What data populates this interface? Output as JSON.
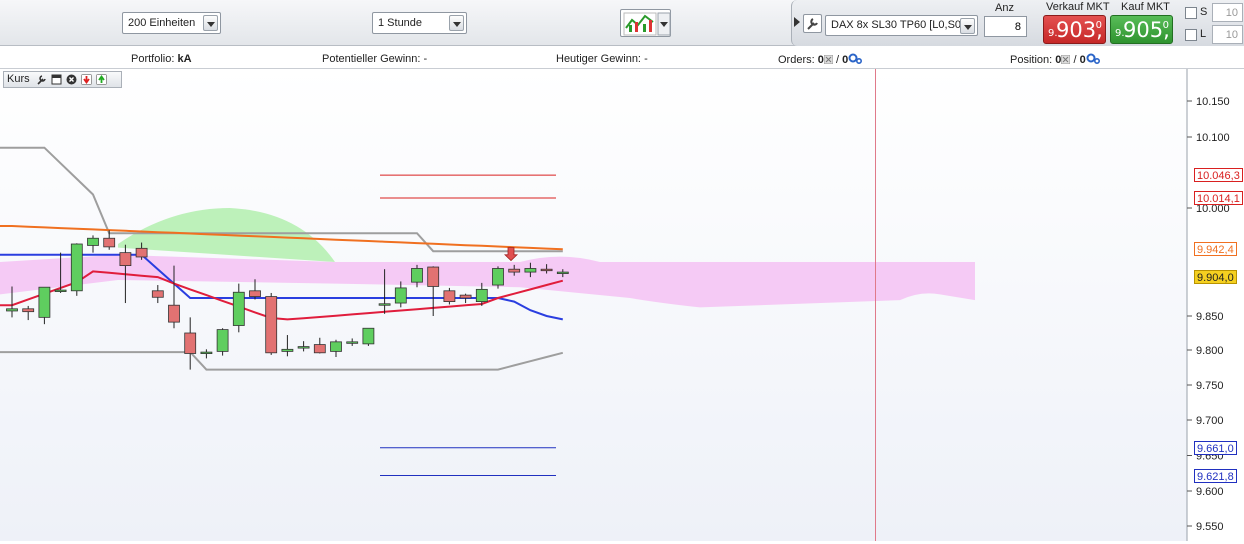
{
  "toolbar": {
    "units_select": "200 Einheiten",
    "interval_select": "1 Stunde",
    "instrument_select": "DAX 8x SL30 TP60 [L0,S0]",
    "anz_label": "Anz",
    "anz_value": "8",
    "sell_label": "Verkauf MKT",
    "buy_label": "Kauf MKT",
    "sell_price": {
      "prefix": "9.",
      "main": "903,",
      "suffix": "0"
    },
    "buy_price": {
      "prefix": "9.",
      "main": "905,",
      "suffix": "0"
    },
    "s_label": "S",
    "l_label": "L",
    "s_value": "10",
    "l_value": "10"
  },
  "infobar": {
    "portfolio_label": "Portfolio:",
    "portfolio_value": "kA",
    "potential_label": "Potentieller Gewinn:",
    "potential_value": "-",
    "today_label": "Heutiger Gewinn:",
    "today_value": "-",
    "orders_label": "Orders:",
    "orders_a": "0",
    "orders_sep": "/",
    "orders_b": "0",
    "position_label": "Position:",
    "position_a": "0",
    "position_sep": "/",
    "position_b": "0"
  },
  "chart_header": {
    "label": "Kurs"
  },
  "colors": {
    "sell": "#d23a3a",
    "buy": "#3fa83f",
    "up_candle": "#5fce5f",
    "down_candle": "#e27272",
    "cloud_bull": "#b6f0b2",
    "cloud_bear": "#f5c2f3",
    "orange_line": "#f07020",
    "blue_line": "#2a3ee0",
    "red_line": "#e01d3c",
    "gray_line": "#9e9e9e",
    "vertical_marker": "#e07a8a"
  },
  "chart_data": {
    "type": "candlestick",
    "yticks": [
      "10.150",
      "10.100",
      "10.000",
      "9.850",
      "9.800",
      "9.750",
      "9.700",
      "9.650",
      "9.600",
      "9.550"
    ],
    "ylim": [
      9528,
      10185
    ],
    "ohlc": [
      [
        9857,
        9891,
        9848,
        9860
      ],
      [
        9860,
        9864,
        9844,
        9856
      ],
      [
        9848,
        9890,
        9838,
        9890
      ],
      [
        9885,
        9938,
        9882,
        9886
      ],
      [
        9885,
        9951,
        9878,
        9950
      ],
      [
        9948,
        9962,
        9938,
        9958
      ],
      [
        9958,
        9969,
        9942,
        9946
      ],
      [
        9938,
        9949,
        9868,
        9920
      ],
      [
        9944,
        9952,
        9928,
        9932
      ],
      [
        9885,
        9893,
        9868,
        9876
      ],
      [
        9865,
        9920,
        9832,
        9841
      ],
      [
        9825,
        9848,
        9772,
        9795
      ],
      [
        9797,
        9801,
        9788,
        9797
      ],
      [
        9798,
        9832,
        9792,
        9830
      ],
      [
        9836,
        9895,
        9826,
        9883
      ],
      [
        9885,
        9901,
        9873,
        9877
      ],
      [
        9877,
        9882,
        9793,
        9796
      ],
      [
        9798,
        9822,
        9791,
        9801
      ],
      [
        9804,
        9813,
        9798,
        9805
      ],
      [
        9808,
        9818,
        9795,
        9796
      ],
      [
        9798,
        9815,
        9790,
        9812
      ],
      [
        9810,
        9817,
        9806,
        9812
      ],
      [
        9809,
        9832,
        9806,
        9832
      ],
      [
        9865,
        9915,
        9853,
        9867
      ],
      [
        9868,
        9898,
        9862,
        9889
      ],
      [
        9897,
        9921,
        9890,
        9916
      ],
      [
        9918,
        9919,
        9850,
        9891
      ],
      [
        9885,
        9889,
        9866,
        9870
      ],
      [
        9879,
        9881,
        9868,
        9875
      ],
      [
        9870,
        9896,
        9864,
        9887
      ],
      [
        9893,
        9919,
        9888,
        9916
      ],
      [
        9915,
        9921,
        9906,
        9911
      ],
      [
        9911,
        9924,
        9904,
        9916
      ],
      [
        9915,
        9922,
        9909,
        9913
      ],
      [
        9910,
        9915,
        9904,
        9911
      ]
    ],
    "ichimoku_base": [
      9875,
      9875,
      9875,
      9875,
      9875,
      9875,
      9875,
      9875,
      9875,
      9875,
      9875,
      9875,
      9875,
      9875,
      9875,
      9875,
      9875,
      9875,
      9875,
      9875,
      9875,
      9875,
      9875,
      9875,
      9875,
      9875,
      9875,
      9875,
      9875,
      9875,
      9875,
      9875,
      9875,
      9875,
      9875
    ],
    "price_labels": [
      {
        "text": "10.046,3",
        "value": 10046.3,
        "color": "#d92020"
      },
      {
        "text": "10.014,1",
        "value": 10014.1,
        "color": "#d92020"
      },
      {
        "text": "9.942,4",
        "value": 9942.4,
        "color": "#f07020"
      },
      {
        "text": "9.904,0",
        "value": 9904.0,
        "color": "#222222",
        "bg": "#f5d020"
      },
      {
        "text": "9.661,0",
        "value": 9661.0,
        "color": "#2030c0"
      },
      {
        "text": "9.621,8",
        "value": 9621.8,
        "color": "#2030c0"
      }
    ],
    "levels": [
      10046.3,
      10014.1,
      9661.0,
      9621.8
    ],
    "signal_arrow_index": 30
  }
}
